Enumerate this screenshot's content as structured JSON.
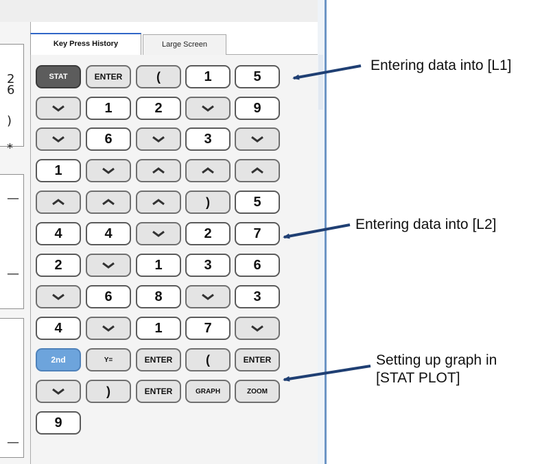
{
  "tabs": {
    "key_press_history": "Key Press History",
    "large_screen": "Large Screen"
  },
  "left_fragments": [
    "2",
    "6",
    ")",
    "*",
    "—",
    "—",
    "—"
  ],
  "keys": {
    "stat": "STAT",
    "enter": "ENTER",
    "lparen": "(",
    "rparen": ")",
    "second": "2nd",
    "yeq": "Y=",
    "graph": "GRAPH",
    "zoom": "ZOOM",
    "d1": "1",
    "d2": "2",
    "d3": "3",
    "d4": "4",
    "d5": "5",
    "d6": "6",
    "d7": "7",
    "d8": "8",
    "d9": "9"
  },
  "annotations": {
    "l1": "Entering data into [L1]",
    "l2": "Entering data into [L2]",
    "graph_line1": "Setting up graph in",
    "graph_line2": "[STAT PLOT]"
  }
}
